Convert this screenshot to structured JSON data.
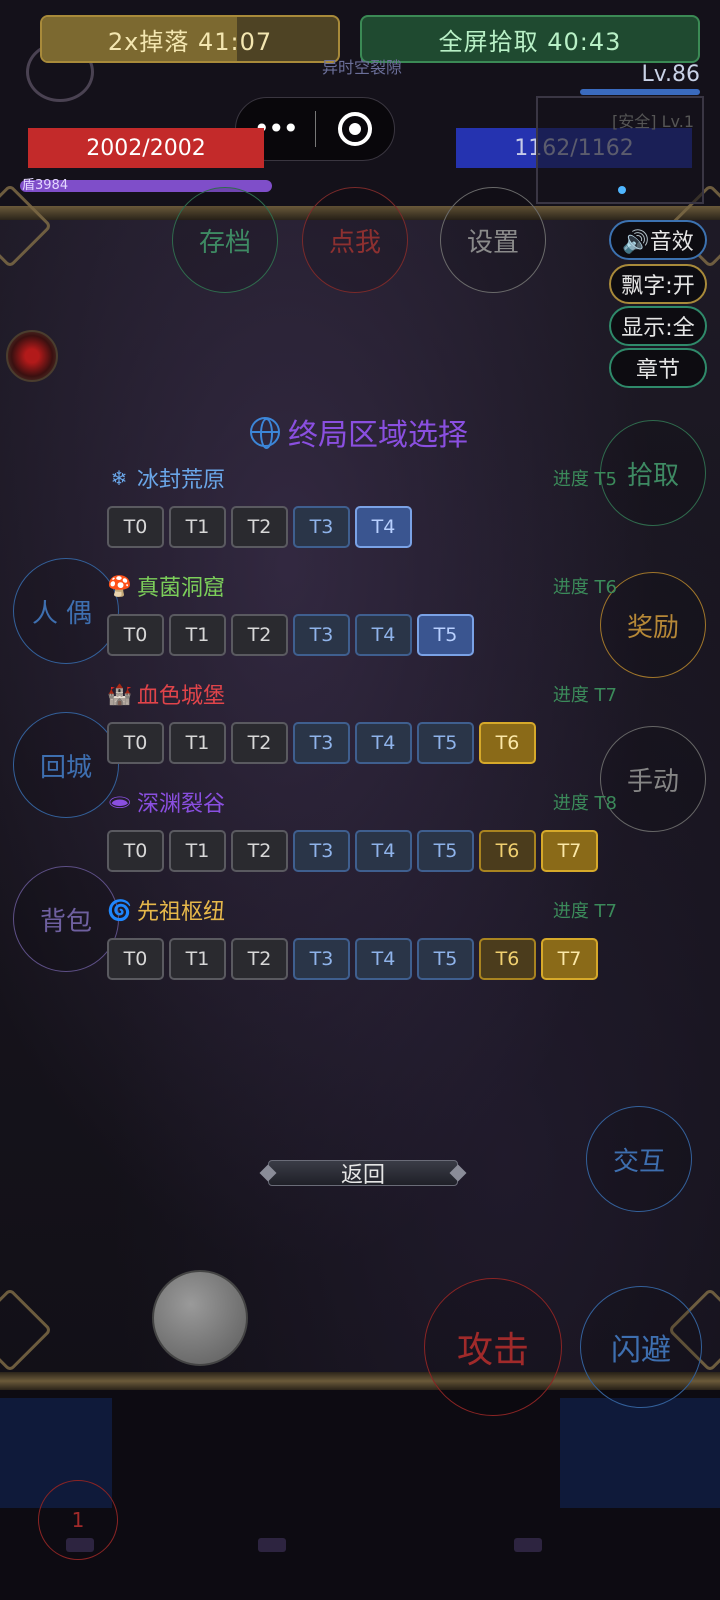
{
  "hud": {
    "drop_buff": {
      "label": "2x掉落 41:07",
      "remaining": 0.66
    },
    "pickup_buff": {
      "label": "全屏拾取 40:43"
    },
    "level": "Lv.86",
    "faint_zone_text": "异时空裂隙",
    "minimap_text": "[安全] Lv.1",
    "hp": "2002/2002",
    "mp": "1162/1162",
    "shield": "盾3984"
  },
  "capsule": {
    "more": "•••"
  },
  "top_buttons": {
    "save": "存档",
    "click_me": "点我",
    "settings": "设置"
  },
  "side_toggles": {
    "sound": "🔊音效",
    "floating_text": "飘字:开",
    "display": "显示:全",
    "chapter": "章节"
  },
  "right_buttons": {
    "pickup": "拾取",
    "reward": "奖励",
    "manual": "手动",
    "interact": "交互",
    "dodge": "闪避",
    "attack": "攻击"
  },
  "left_buttons": {
    "puppet": "人偶",
    "town": "回城",
    "bag": "背包"
  },
  "panel": {
    "title": "终局区域选择",
    "return": "返回",
    "regions": [
      {
        "icon": "❄",
        "name": "冰封荒原",
        "color": "#6aa6e8",
        "progress": "进度 T5",
        "tiers": [
          "T0",
          "T1",
          "T2",
          "T3",
          "T4"
        ]
      },
      {
        "icon": "🍄",
        "name": "真菌洞窟",
        "color": "#7ccf5a",
        "progress": "进度 T6",
        "tiers": [
          "T0",
          "T1",
          "T2",
          "T3",
          "T4",
          "T5"
        ]
      },
      {
        "icon": "🏰",
        "name": "血色城堡",
        "color": "#e0444a",
        "progress": "进度 T7",
        "tiers": [
          "T0",
          "T1",
          "T2",
          "T3",
          "T4",
          "T5",
          "T6"
        ]
      },
      {
        "icon": "🕳",
        "name": "深渊裂谷",
        "color": "#8a4fe0",
        "progress": "进度 T8",
        "tiers": [
          "T0",
          "T1",
          "T2",
          "T3",
          "T4",
          "T5",
          "T6",
          "T7"
        ]
      },
      {
        "icon": "🌀",
        "name": "先祖枢纽",
        "color": "#e6b84a",
        "progress": "进度 T7",
        "tiers": [
          "T0",
          "T1",
          "T2",
          "T3",
          "T4",
          "T5",
          "T6",
          "T7"
        ]
      }
    ]
  },
  "skill_slot": "1"
}
